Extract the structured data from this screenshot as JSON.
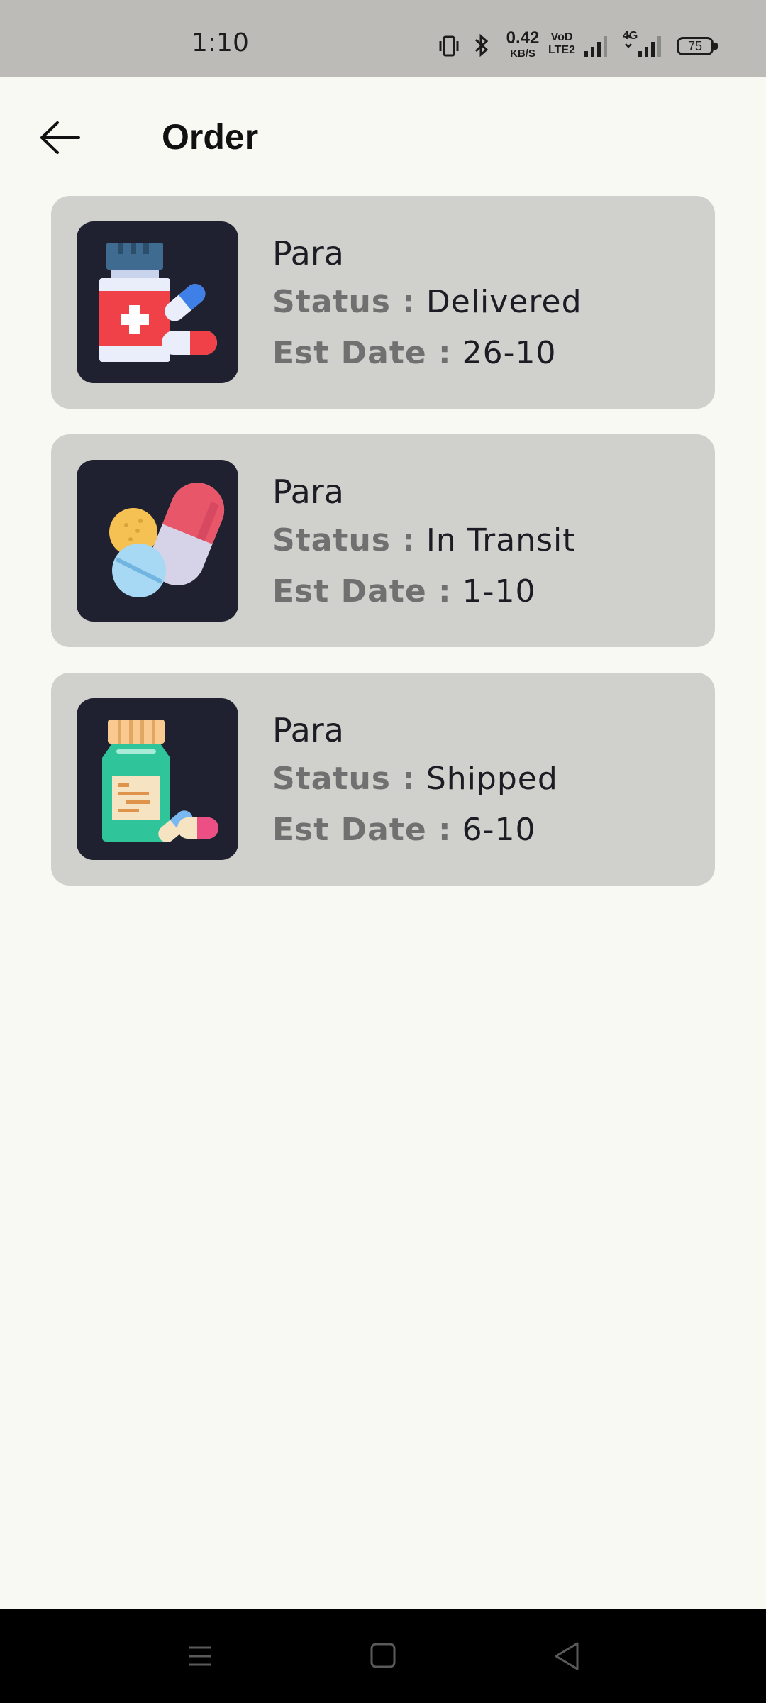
{
  "status_bar": {
    "time": "1:10",
    "network_speed_value": "0.42",
    "network_speed_unit": "KB/S",
    "volte_line1": "VoD",
    "volte_line2": "LTE2",
    "network_type": "4G",
    "battery_level": "75"
  },
  "header": {
    "title": "Order"
  },
  "orders": [
    {
      "name": "Para",
      "status_label": "Status :",
      "status": "Delivered",
      "date_label": "Est Date :",
      "date": "26-10",
      "image_icon": "medicine-bottle-pills-icon"
    },
    {
      "name": "Para",
      "status_label": "Status :",
      "status": "In Transit",
      "date_label": "Est Date :",
      "date": "1-10",
      "image_icon": "pills-capsule-icon"
    },
    {
      "name": "Para",
      "status_label": "Status :",
      "status": "Shipped",
      "date_label": "Est Date :",
      "date": "6-10",
      "image_icon": "syrup-bottle-pills-icon"
    }
  ],
  "nav_bar": {
    "icons": [
      "menu-icon",
      "home-icon",
      "back-triangle-icon"
    ]
  },
  "colors": {
    "background": "#f9f9f4",
    "card": "#d0d0cc",
    "thumbnail_bg": "#1f2130",
    "status_bar": "#bcbbb7"
  }
}
